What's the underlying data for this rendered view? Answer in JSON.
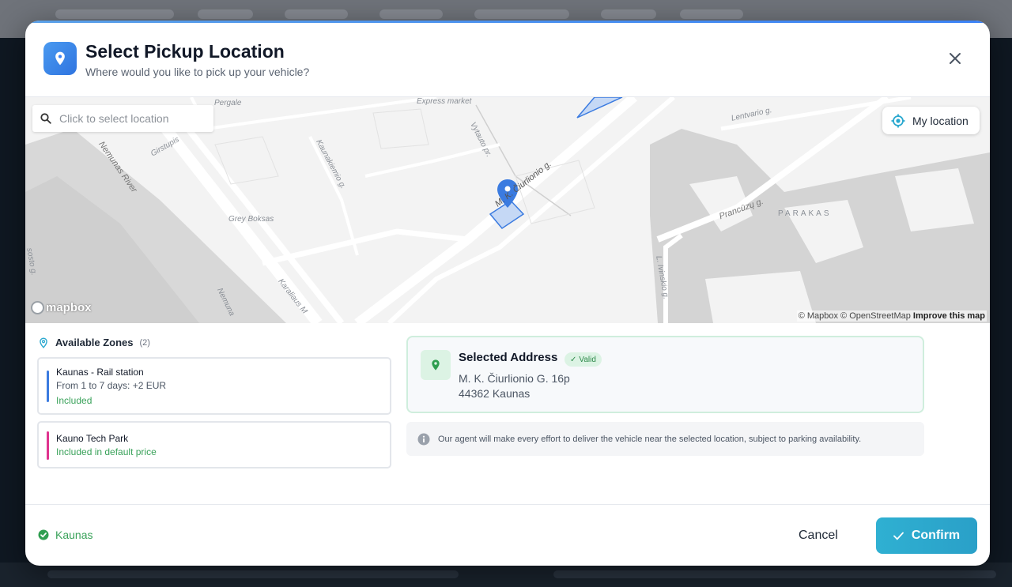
{
  "header": {
    "title": "Select Pickup Location",
    "subtitle": "Where would you like to pick up your vehicle?"
  },
  "map": {
    "search_placeholder": "Click to select location",
    "my_location_label": "My location",
    "logo_text": "mapbox",
    "attribution": "© Mapbox © OpenStreetMap",
    "improve_link": "Improve this map",
    "labels": {
      "pergale": "Pergale",
      "express_market": "Express market",
      "vytauto": "Vytauto pr.",
      "ciurlionio": "M. K. Čiurlionio g.",
      "lentvario": "Lentvario g.",
      "nemunas_river": "Nemunas River",
      "girstupis": "Girstupis",
      "kaunakiemio": "Kaunakiemio g.",
      "grey_boksas": "Grey Boksas",
      "pranciuzu": "Prancūzų g.",
      "parakas": "PARAKAS",
      "ivinskio": "L. Ivinskio g.",
      "karaliaus": "Karaliaus M",
      "nemuna": "Nemuna",
      "sosto": "sosto g."
    }
  },
  "zones": {
    "title": "Available Zones",
    "count": "(2)",
    "items": [
      {
        "name": "Kaunas - Rail station",
        "detail": "From 1 to 7 days: +2 EUR",
        "status": "Included",
        "color": "#3b7be0"
      },
      {
        "name": "Kauno Tech Park",
        "status": "Included in default price",
        "color": "#e0338f"
      }
    ]
  },
  "selected_address": {
    "title": "Selected Address",
    "badge": "Valid",
    "line1": "M. K. Čiurlionio G. 16p",
    "line2": "44362 Kaunas"
  },
  "notice": "Our agent will make every effort to deliver the vehicle near the selected location, subject to parking availability.",
  "footer": {
    "city": "Kaunas",
    "cancel_label": "Cancel",
    "confirm_label": "Confirm"
  },
  "colors": {
    "accent": "#3b82f6",
    "success": "#3aa25a",
    "confirm": "#2aa8cf"
  }
}
